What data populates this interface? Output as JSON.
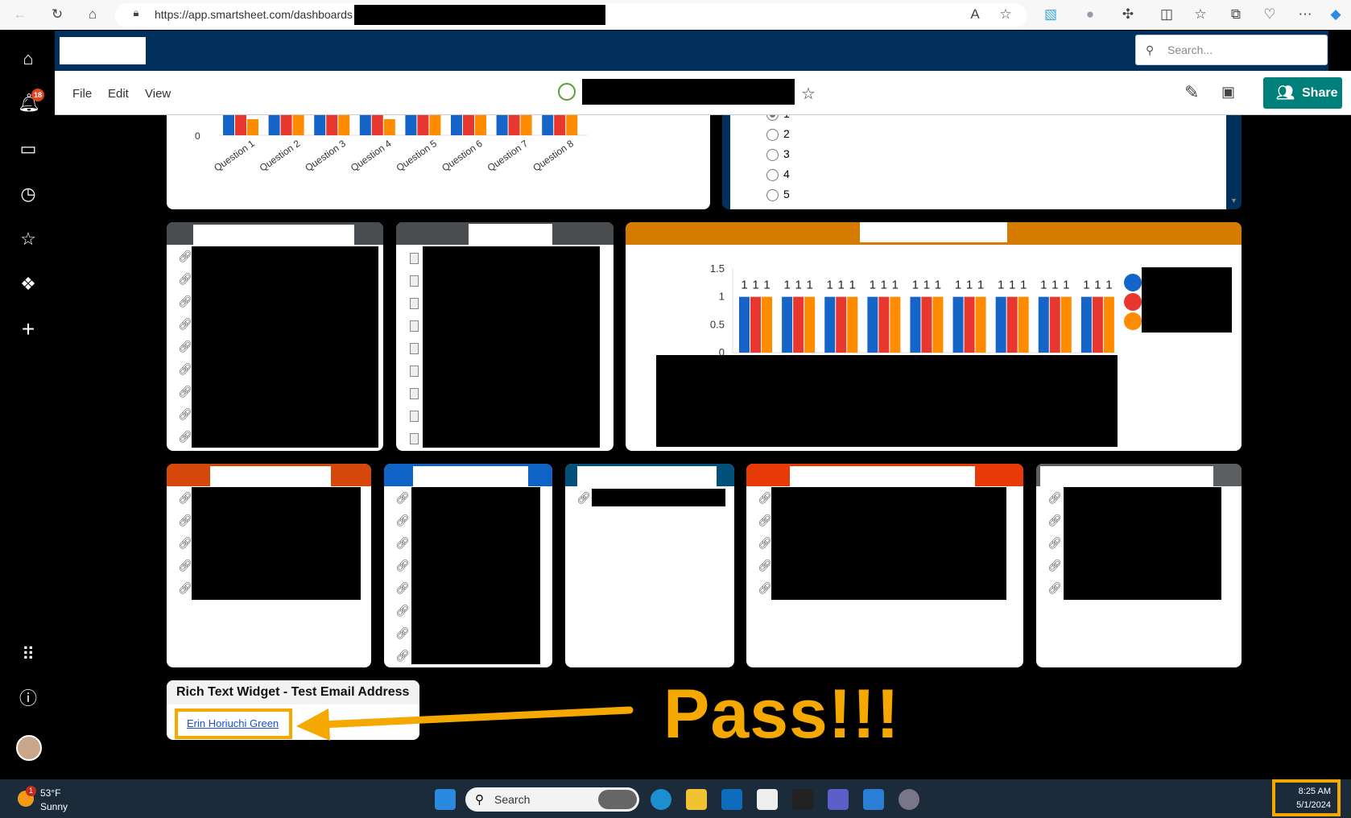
{
  "browser": {
    "url": "https://app.smartsheet.com/dashboards"
  },
  "app": {
    "notification_count": "18",
    "menu": [
      "File",
      "Edit",
      "View"
    ],
    "search_placeholder": "Search...",
    "share_label": "Share"
  },
  "radio_widget": {
    "options": [
      "1",
      "2",
      "3",
      "4",
      "5"
    ],
    "selected": "1"
  },
  "rich_text": {
    "title": "Rich Text Widget - Test Email Address",
    "link": "Erin Horiuchi Green"
  },
  "annotation": {
    "text": "Pass!!!",
    "color": "#f5a800"
  },
  "taskbar": {
    "weather_temp": "53°F",
    "weather_desc": "Sunny",
    "weather_badge": "1",
    "search": "Search",
    "time": "8:25 AM",
    "date": "5/1/2024"
  },
  "colors": {
    "navy": "#00305b",
    "share": "#00807a",
    "series": [
      "#1565c8",
      "#e8372f",
      "#ff8c00"
    ]
  },
  "chart_data": [
    {
      "type": "bar",
      "categories": [
        "Question 1",
        "Question 2",
        "Question 3",
        "Question 4",
        "Question 5",
        "Question 6",
        "Question 7",
        "Question 8"
      ],
      "ytick_labels": [
        "0"
      ],
      "series_count": 3,
      "note_visible": "cropped"
    },
    {
      "type": "bar",
      "ytick_labels": [
        "0",
        "0.5",
        "1",
        "1.5"
      ],
      "ylim": [
        0,
        1.5
      ],
      "groups": 9,
      "series": [
        {
          "values": [
            1,
            1,
            1,
            1,
            1,
            1,
            1,
            1,
            1
          ]
        },
        {
          "values": [
            1,
            1,
            1,
            1,
            1,
            1,
            1,
            1,
            1
          ]
        },
        {
          "values": [
            1,
            1,
            1,
            1,
            1,
            1,
            1,
            1,
            1
          ]
        }
      ]
    }
  ]
}
